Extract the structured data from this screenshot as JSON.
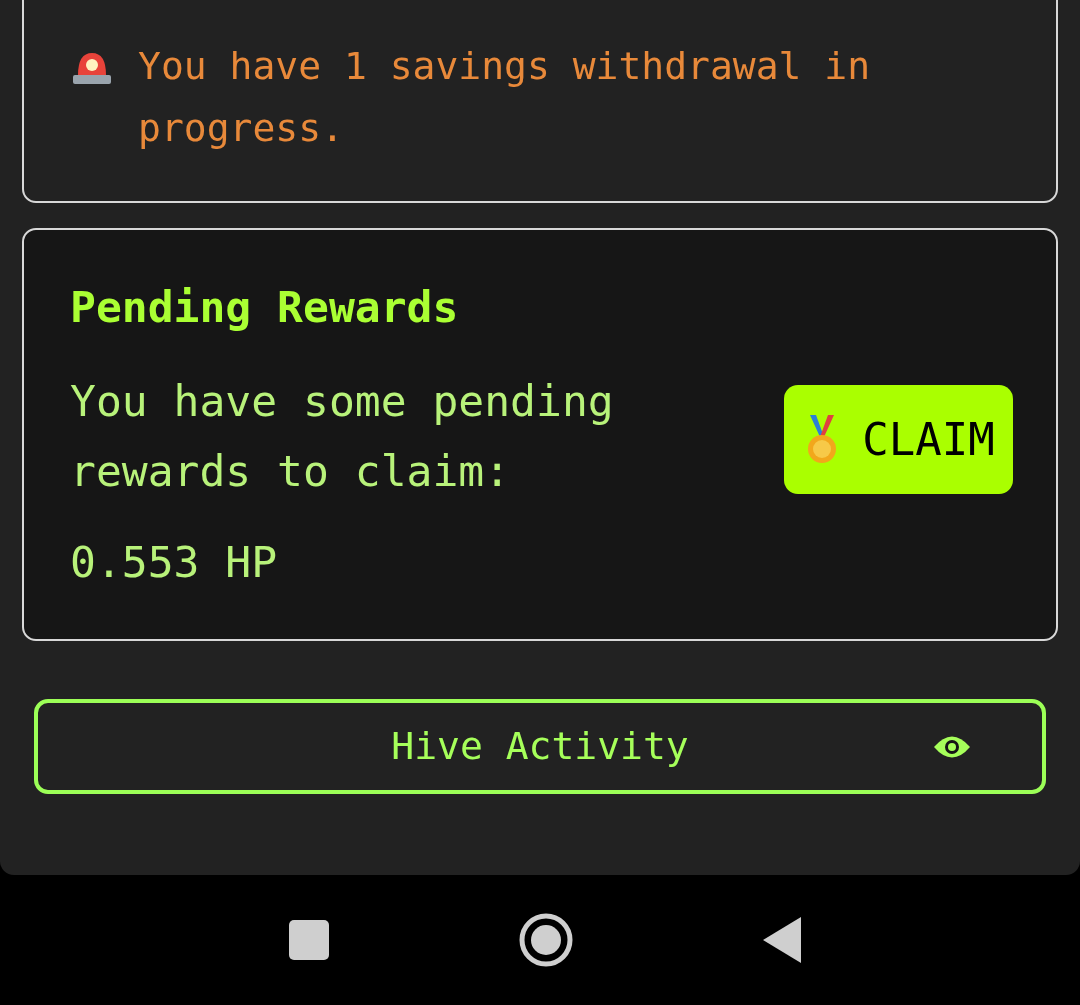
{
  "alert": {
    "text": "You have 1 savings withdrawal in progress."
  },
  "rewards": {
    "title": "Pending Rewards",
    "text": "You have some pending rewards to claim:",
    "amount": "0.553 HP",
    "button": "CLAIM"
  },
  "activity_button": {
    "label": "Hive Activity"
  }
}
